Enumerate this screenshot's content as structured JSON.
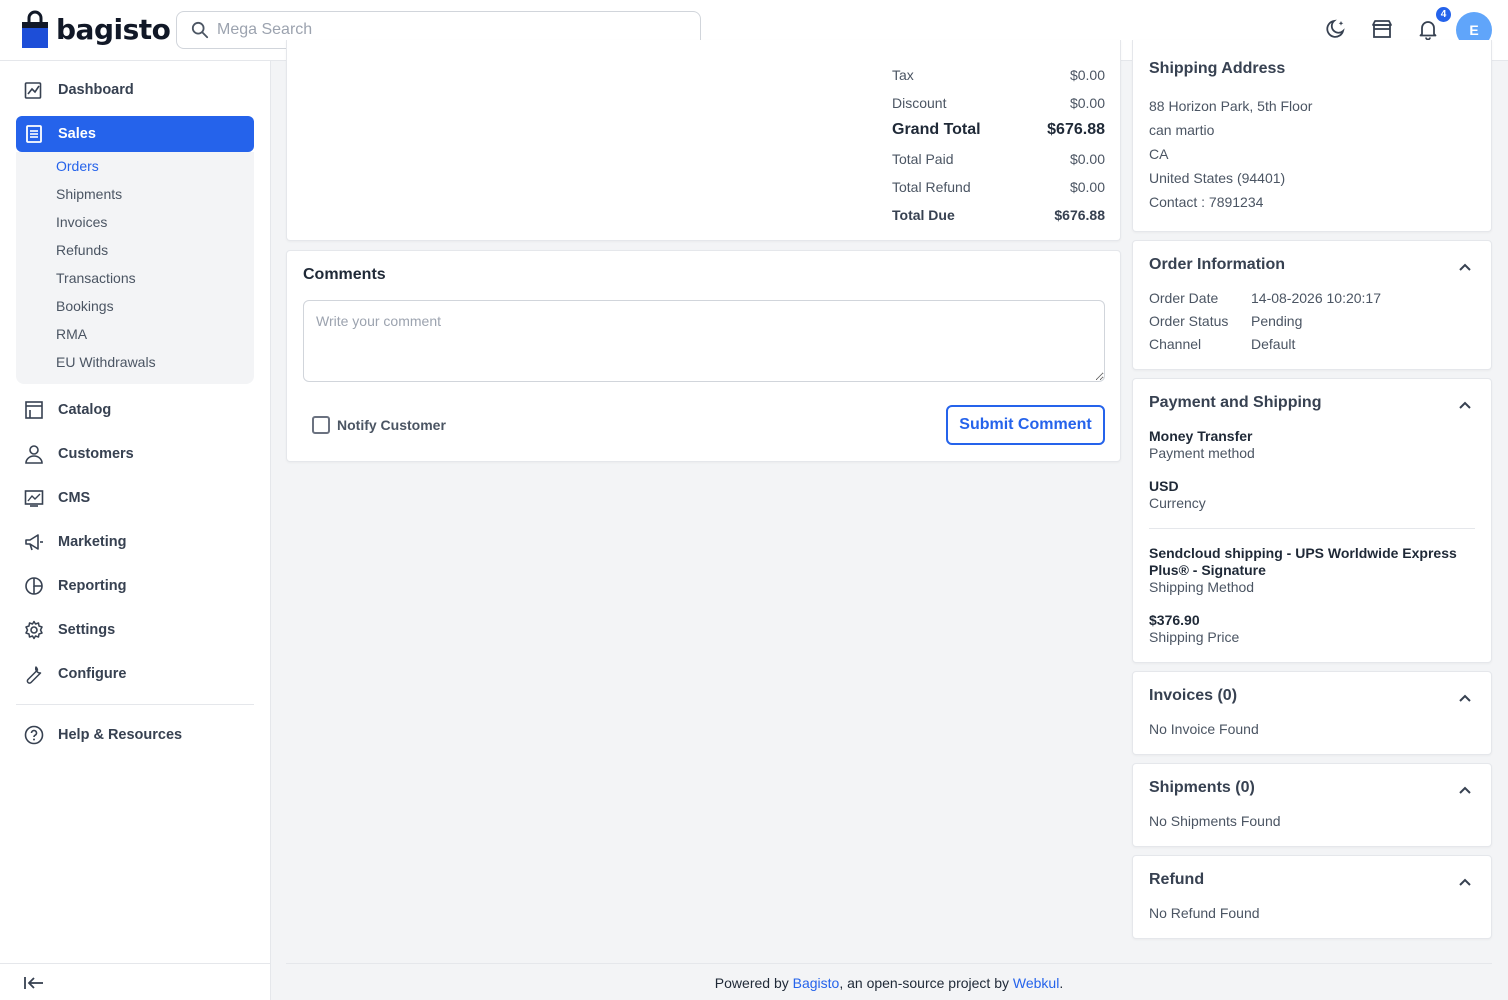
{
  "brand": {
    "name": "bagisto",
    "accent": "#2563eb"
  },
  "search": {
    "placeholder": "Mega Search"
  },
  "header": {
    "notifications_count": "4",
    "avatar_initial": "E"
  },
  "sidebar": {
    "items": [
      {
        "label": "Dashboard"
      },
      {
        "label": "Sales"
      },
      {
        "label": "Catalog"
      },
      {
        "label": "Customers"
      },
      {
        "label": "CMS"
      },
      {
        "label": "Marketing"
      },
      {
        "label": "Reporting"
      },
      {
        "label": "Settings"
      },
      {
        "label": "Configure"
      },
      {
        "label": "Help & Resources"
      }
    ],
    "sales_submenu": [
      "Orders",
      "Shipments",
      "Invoices",
      "Refunds",
      "Transactions",
      "Bookings",
      "RMA",
      "EU Withdrawals"
    ]
  },
  "summary": {
    "rows": [
      {
        "label": "Tax",
        "value": "$0.00"
      },
      {
        "label": "Discount",
        "value": "$0.00"
      },
      {
        "label": "Grand Total",
        "value": "$676.88"
      },
      {
        "label": "Total Paid",
        "value": "$0.00"
      },
      {
        "label": "Total Refund",
        "value": "$0.00"
      },
      {
        "label": "Total Due",
        "value": "$676.88"
      }
    ]
  },
  "comments": {
    "title": "Comments",
    "placeholder": "Write your comment",
    "notify_label": "Notify Customer",
    "submit_label": "Submit Comment"
  },
  "shipping_address": {
    "title": "Shipping Address",
    "lines": [
      "88 Horizon Park, 5th Floor",
      "can martio",
      "CA",
      "United States (94401)",
      "Contact : 7891234"
    ]
  },
  "order_info": {
    "title": "Order Information",
    "rows": [
      {
        "label": "Order Date",
        "value": "14-08-2026 10:20:17"
      },
      {
        "label": "Order Status",
        "value": "Pending"
      },
      {
        "label": "Channel",
        "value": "Default"
      }
    ]
  },
  "payment_shipping": {
    "title": "Payment and Shipping",
    "payment_method": "Money Transfer",
    "payment_method_label": "Payment method",
    "currency": "USD",
    "currency_label": "Currency",
    "shipping_method_line1": "Sendcloud shipping - UPS Worldwide Express",
    "shipping_method_line2": "Plus® - Signature",
    "shipping_method_label": "Shipping Method",
    "shipping_price": "$376.90",
    "shipping_price_label": "Shipping Price"
  },
  "invoices": {
    "title": "Invoices (0)",
    "empty": "No Invoice Found"
  },
  "shipments": {
    "title": "Shipments (0)",
    "empty": "No Shipments Found"
  },
  "refund": {
    "title": "Refund",
    "empty": "No Refund Found"
  },
  "footer": {
    "prefix": "Powered by ",
    "link1": "Bagisto",
    "middle": ", an open-source project by ",
    "link2": "Webkul",
    "suffix": "."
  }
}
